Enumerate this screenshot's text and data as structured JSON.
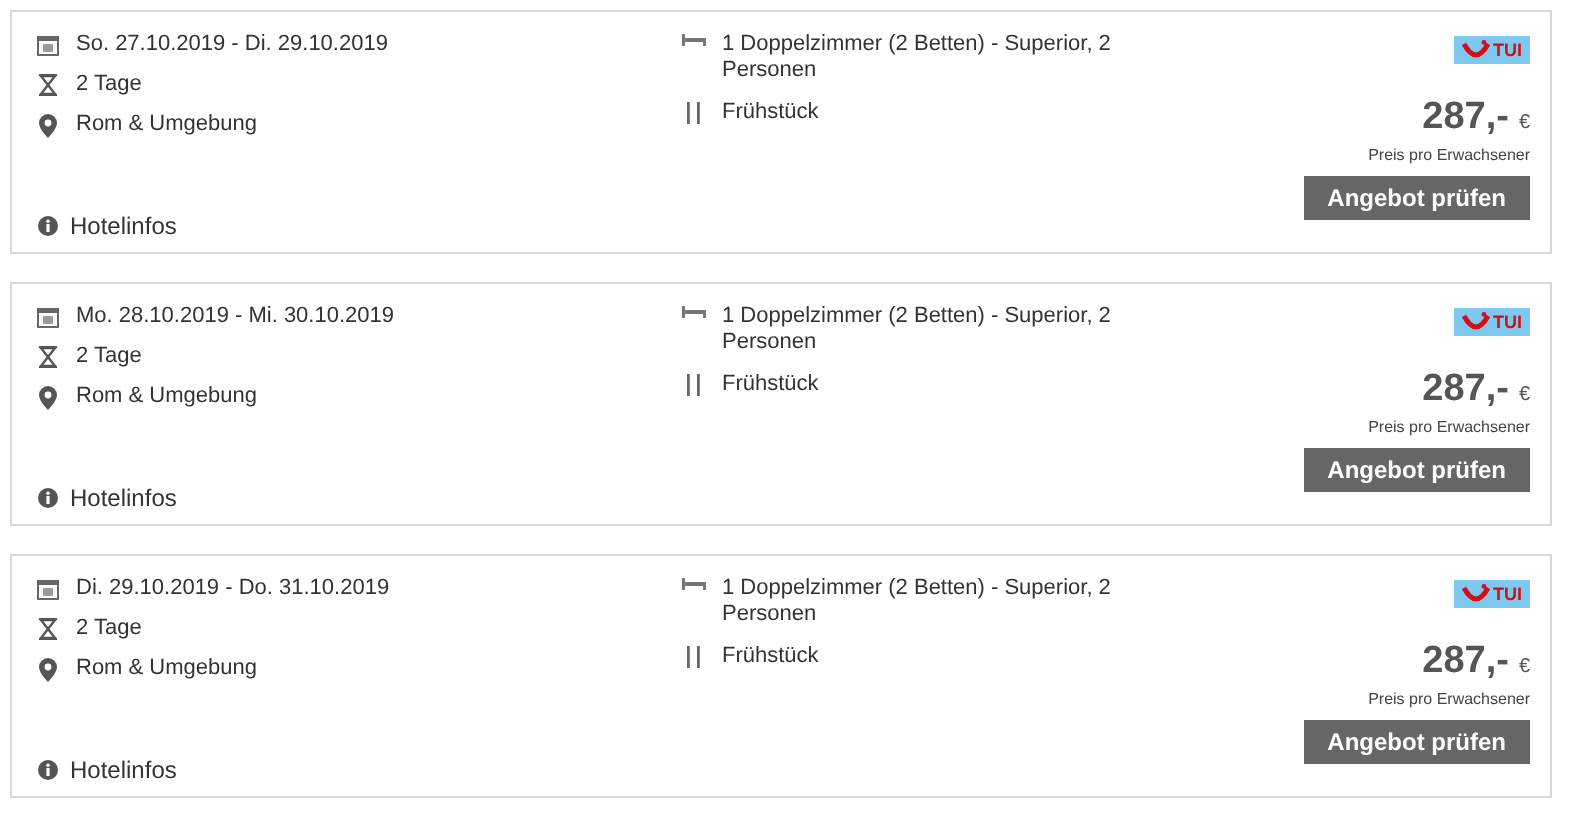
{
  "offers": [
    {
      "dates": "So. 27.10.2019 - Di. 29.10.2019",
      "duration": "2 Tage",
      "location": "Rom & Umgebung",
      "room": "1 Doppelzimmer (2 Betten) - Superior, 2 Personen",
      "board": "Frühstück",
      "operator": "TUI",
      "price": "287,-",
      "currency": "€",
      "price_note": "Preis pro Erwachsener",
      "button": "Angebot prüfen",
      "info_link": "Hotelinfos"
    },
    {
      "dates": "Mo. 28.10.2019 - Mi. 30.10.2019",
      "duration": "2 Tage",
      "location": "Rom & Umgebung",
      "room": "1 Doppelzimmer (2 Betten) - Superior, 2 Personen",
      "board": "Frühstück",
      "operator": "TUI",
      "price": "287,-",
      "currency": "€",
      "price_note": "Preis pro Erwachsener",
      "button": "Angebot prüfen",
      "info_link": "Hotelinfos"
    },
    {
      "dates": "Di. 29.10.2019 - Do. 31.10.2019",
      "duration": "2 Tage",
      "location": "Rom & Umgebung",
      "room": "1 Doppelzimmer (2 Betten) - Superior, 2 Personen",
      "board": "Frühstück",
      "operator": "TUI",
      "price": "287,-",
      "currency": "€",
      "price_note": "Preis pro Erwachsener",
      "button": "Angebot prüfen",
      "info_link": "Hotelinfos"
    }
  ]
}
